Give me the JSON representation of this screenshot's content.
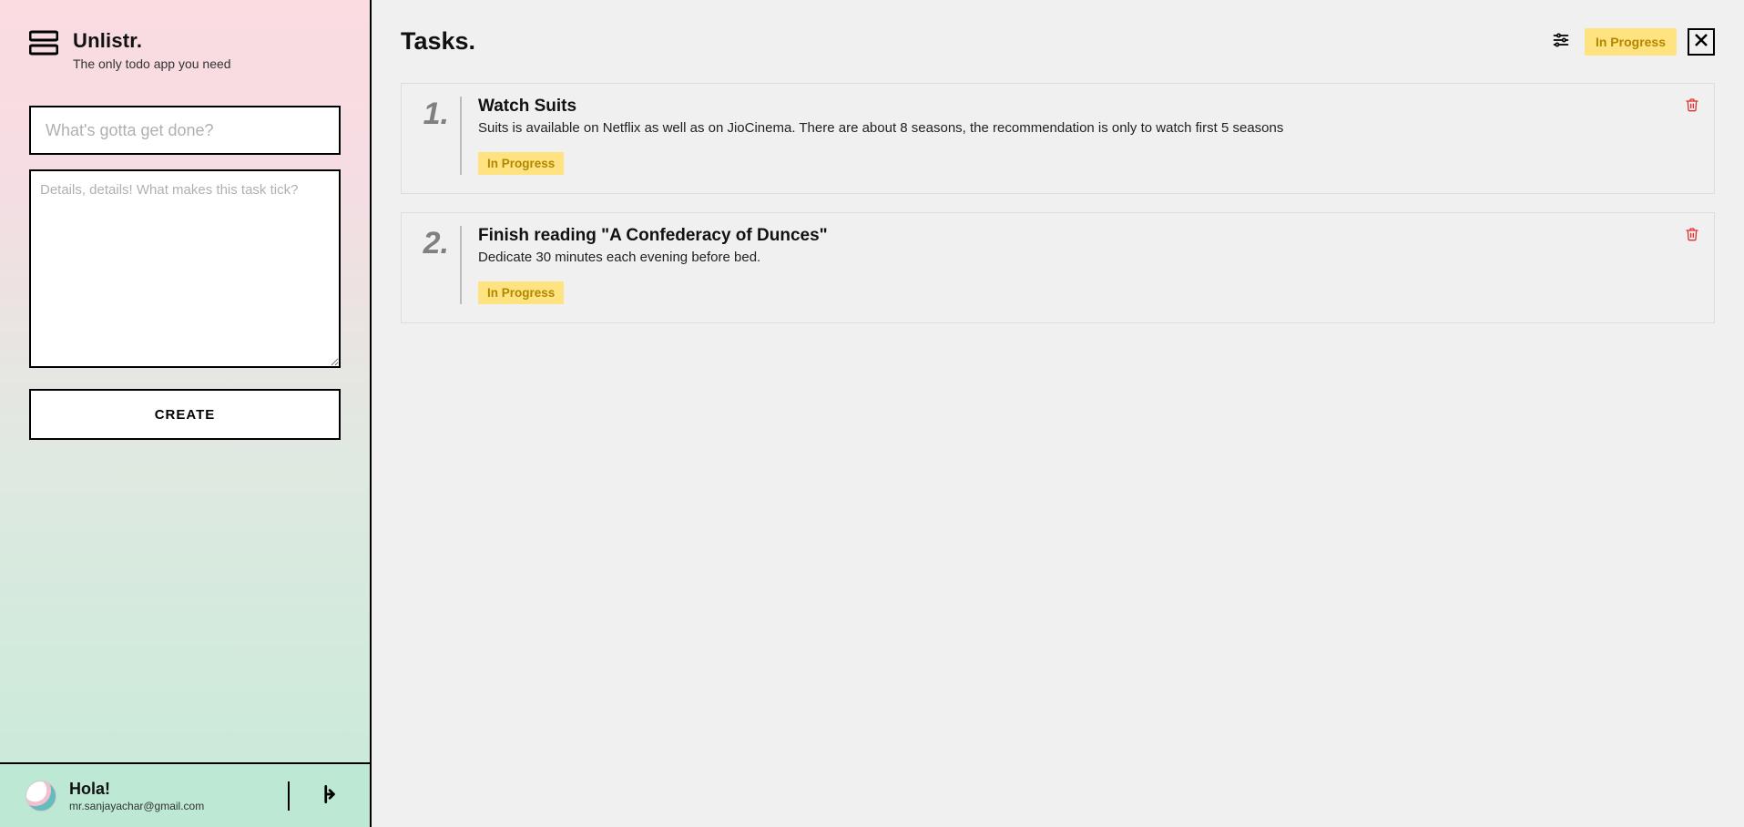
{
  "brand": {
    "title": "Unlistr.",
    "subtitle": "The only todo app you need"
  },
  "form": {
    "title_placeholder": "What's gotta get done?",
    "details_placeholder": "Details, details! What makes this task tick?",
    "create_label": "CREATE"
  },
  "user": {
    "greeting": "Hola!",
    "email": "mr.sanjayachar@gmail.com"
  },
  "main": {
    "heading": "Tasks.",
    "filter_chip": "In Progress"
  },
  "tasks": [
    {
      "num": "1.",
      "title": "Watch Suits",
      "desc": "Suits is available on Netflix as well as on JioCinema. There are about 8 seasons, the recommendation is only to watch first 5 seasons",
      "status": "In Progress"
    },
    {
      "num": "2.",
      "title": "Finish reading \"A Confederacy of Dunces\"",
      "desc": "Dedicate 30 minutes each evening before bed.",
      "status": "In Progress"
    }
  ]
}
